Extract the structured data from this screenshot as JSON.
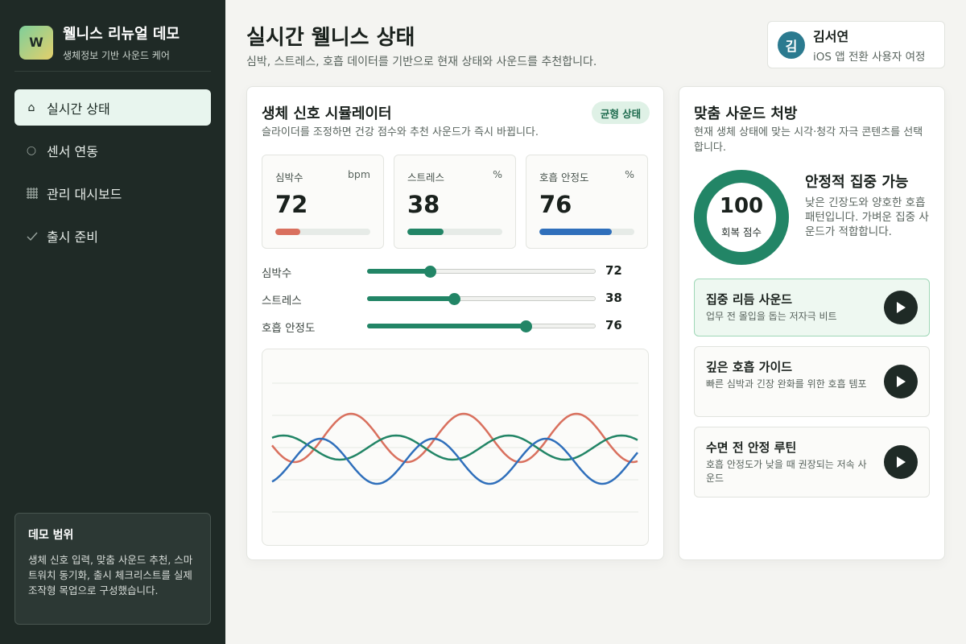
{
  "app": {
    "logo_letter": "W",
    "title": "웰니스 리뉴얼 데모",
    "subtitle": "생체정보 기반 사운드 케어"
  },
  "sidebar": {
    "items": [
      {
        "label": "실시간 상태",
        "icon": "home-icon",
        "active": true
      },
      {
        "label": "센서 연동",
        "icon": "circle-icon",
        "active": false
      },
      {
        "label": "관리 대시보드",
        "icon": "grid-icon",
        "active": false
      },
      {
        "label": "출시 준비",
        "icon": "check-icon",
        "active": false
      }
    ],
    "demo": {
      "title": "데모 범위",
      "text": "생체 신호 입력, 맞춤 사운드 추천, 스마트워치 동기화, 출시 체크리스트를 실제 조작형 목업으로 구성했습니다."
    }
  },
  "header": {
    "title": "실시간 웰니스 상태",
    "subtitle": "심박, 스트레스, 호흡 데이터를 기반으로 현재 상태와 사운드를 추천합니다."
  },
  "user": {
    "avatar": "김",
    "name": "김서연",
    "role": "iOS 앱 전환 사용자 여정"
  },
  "simulator": {
    "title": "생체 신호 시뮬레이터",
    "subtitle": "슬라이더를 조정하면 건강 점수와 추천 사운드가 즉시 바뀝니다.",
    "badge": "균형 상태",
    "metrics": [
      {
        "label": "심박수",
        "unit": "bpm",
        "value": "72",
        "level": 0.26,
        "color": "#d9705e"
      },
      {
        "label": "스트레스",
        "unit": "%",
        "value": "38",
        "level": 0.38,
        "color": "#228566"
      },
      {
        "label": "호흡 안정도",
        "unit": "%",
        "value": "76",
        "level": 0.76,
        "color": "#2f6fbb"
      }
    ],
    "sliders": [
      {
        "label": "심박수",
        "value": "72",
        "level": 0.27
      },
      {
        "label": "스트레스",
        "value": "38",
        "level": 0.375
      },
      {
        "label": "호흡 안정도",
        "value": "76",
        "level": 0.69
      }
    ],
    "wave_colors": [
      "#d9705e",
      "#228566",
      "#2f6fbb"
    ]
  },
  "sound": {
    "title": "맞춤 사운드 처방",
    "subtitle": "현재 생체 상태에 맞는 시각·청각 자극 콘텐츠를 선택합니다.",
    "score": "100",
    "score_label": "회복 점수",
    "score_level": 1.0,
    "ring_color": "#228566",
    "state_title": "안정적 집중 가능",
    "state_desc": "낮은 긴장도와 양호한 호흡 패턴입니다. 가벼운 집중 사운드가 적합합니다.",
    "tracks": [
      {
        "title": "집중 리듬 사운드",
        "desc": "업무 전 몰입을 돕는 저자극 비트",
        "active": true
      },
      {
        "title": "깊은 호흡 가이드",
        "desc": "빠른 심박과 긴장 완화를 위한 호흡 템포",
        "active": false
      },
      {
        "title": "수면 전 안정 루틴",
        "desc": "호흡 안정도가 낮을 때 권장되는 저속 사운드",
        "active": false
      }
    ]
  }
}
